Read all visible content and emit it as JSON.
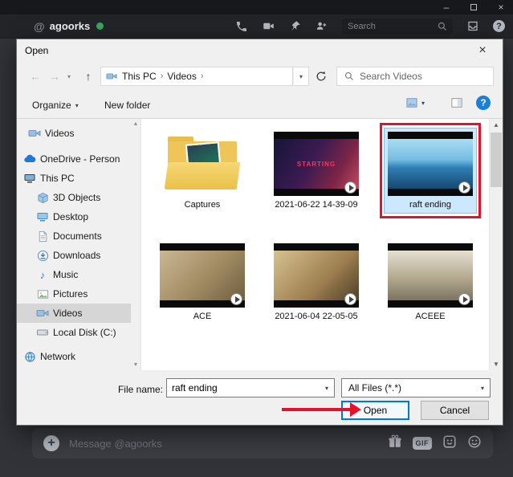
{
  "discord": {
    "header": {
      "name": "agoorks",
      "search_placeholder": "Search"
    },
    "message_bar": {
      "placeholder": "Message @agoorks",
      "gif_label": "GIF"
    }
  },
  "dialog": {
    "title": "Open",
    "nav": {
      "breadcrumb": [
        "This PC",
        "Videos"
      ],
      "search_placeholder": "Search Videos"
    },
    "toolbar": {
      "organize_label": "Organize",
      "new_folder_label": "New folder"
    },
    "sidebar": {
      "items": [
        {
          "label": "Videos"
        },
        {
          "label": "OneDrive - Person"
        },
        {
          "label": "This PC"
        },
        {
          "label": "3D Objects"
        },
        {
          "label": "Desktop"
        },
        {
          "label": "Documents"
        },
        {
          "label": "Downloads"
        },
        {
          "label": "Music"
        },
        {
          "label": "Pictures"
        },
        {
          "label": "Videos"
        },
        {
          "label": "Local Disk (C:)"
        },
        {
          "label": "Network"
        }
      ]
    },
    "files": {
      "items": [
        {
          "name": "Captures",
          "type": "folder"
        },
        {
          "name": "2021-06-22 14-39-09",
          "type": "video",
          "overlay_text": "STARTING"
        },
        {
          "name": "raft ending",
          "type": "video",
          "selected": true
        },
        {
          "name": "ACE",
          "type": "video"
        },
        {
          "name": "2021-06-04 22-05-05",
          "type": "video"
        },
        {
          "name": "ACEEE",
          "type": "video"
        }
      ]
    },
    "footer": {
      "file_name_label": "File name:",
      "file_name_value": "raft ending",
      "file_type_value": "All Files (*.*)",
      "open_label": "Open",
      "cancel_label": "Cancel"
    }
  },
  "icons": {
    "back": "←",
    "forward": "→",
    "up": "↑",
    "chevron_down": "▾",
    "breadcrumb_sep": "›",
    "scroll_up": "▲",
    "scroll_down": "▼",
    "close": "×",
    "minimize": "–",
    "music_note": "♪",
    "plus": "+",
    "help": "?"
  },
  "colors": {
    "accent_blue": "#0078d7",
    "selection_blue": "#cce8ff",
    "annotation_red": "#e8112d",
    "online_green": "#3ba55d"
  }
}
